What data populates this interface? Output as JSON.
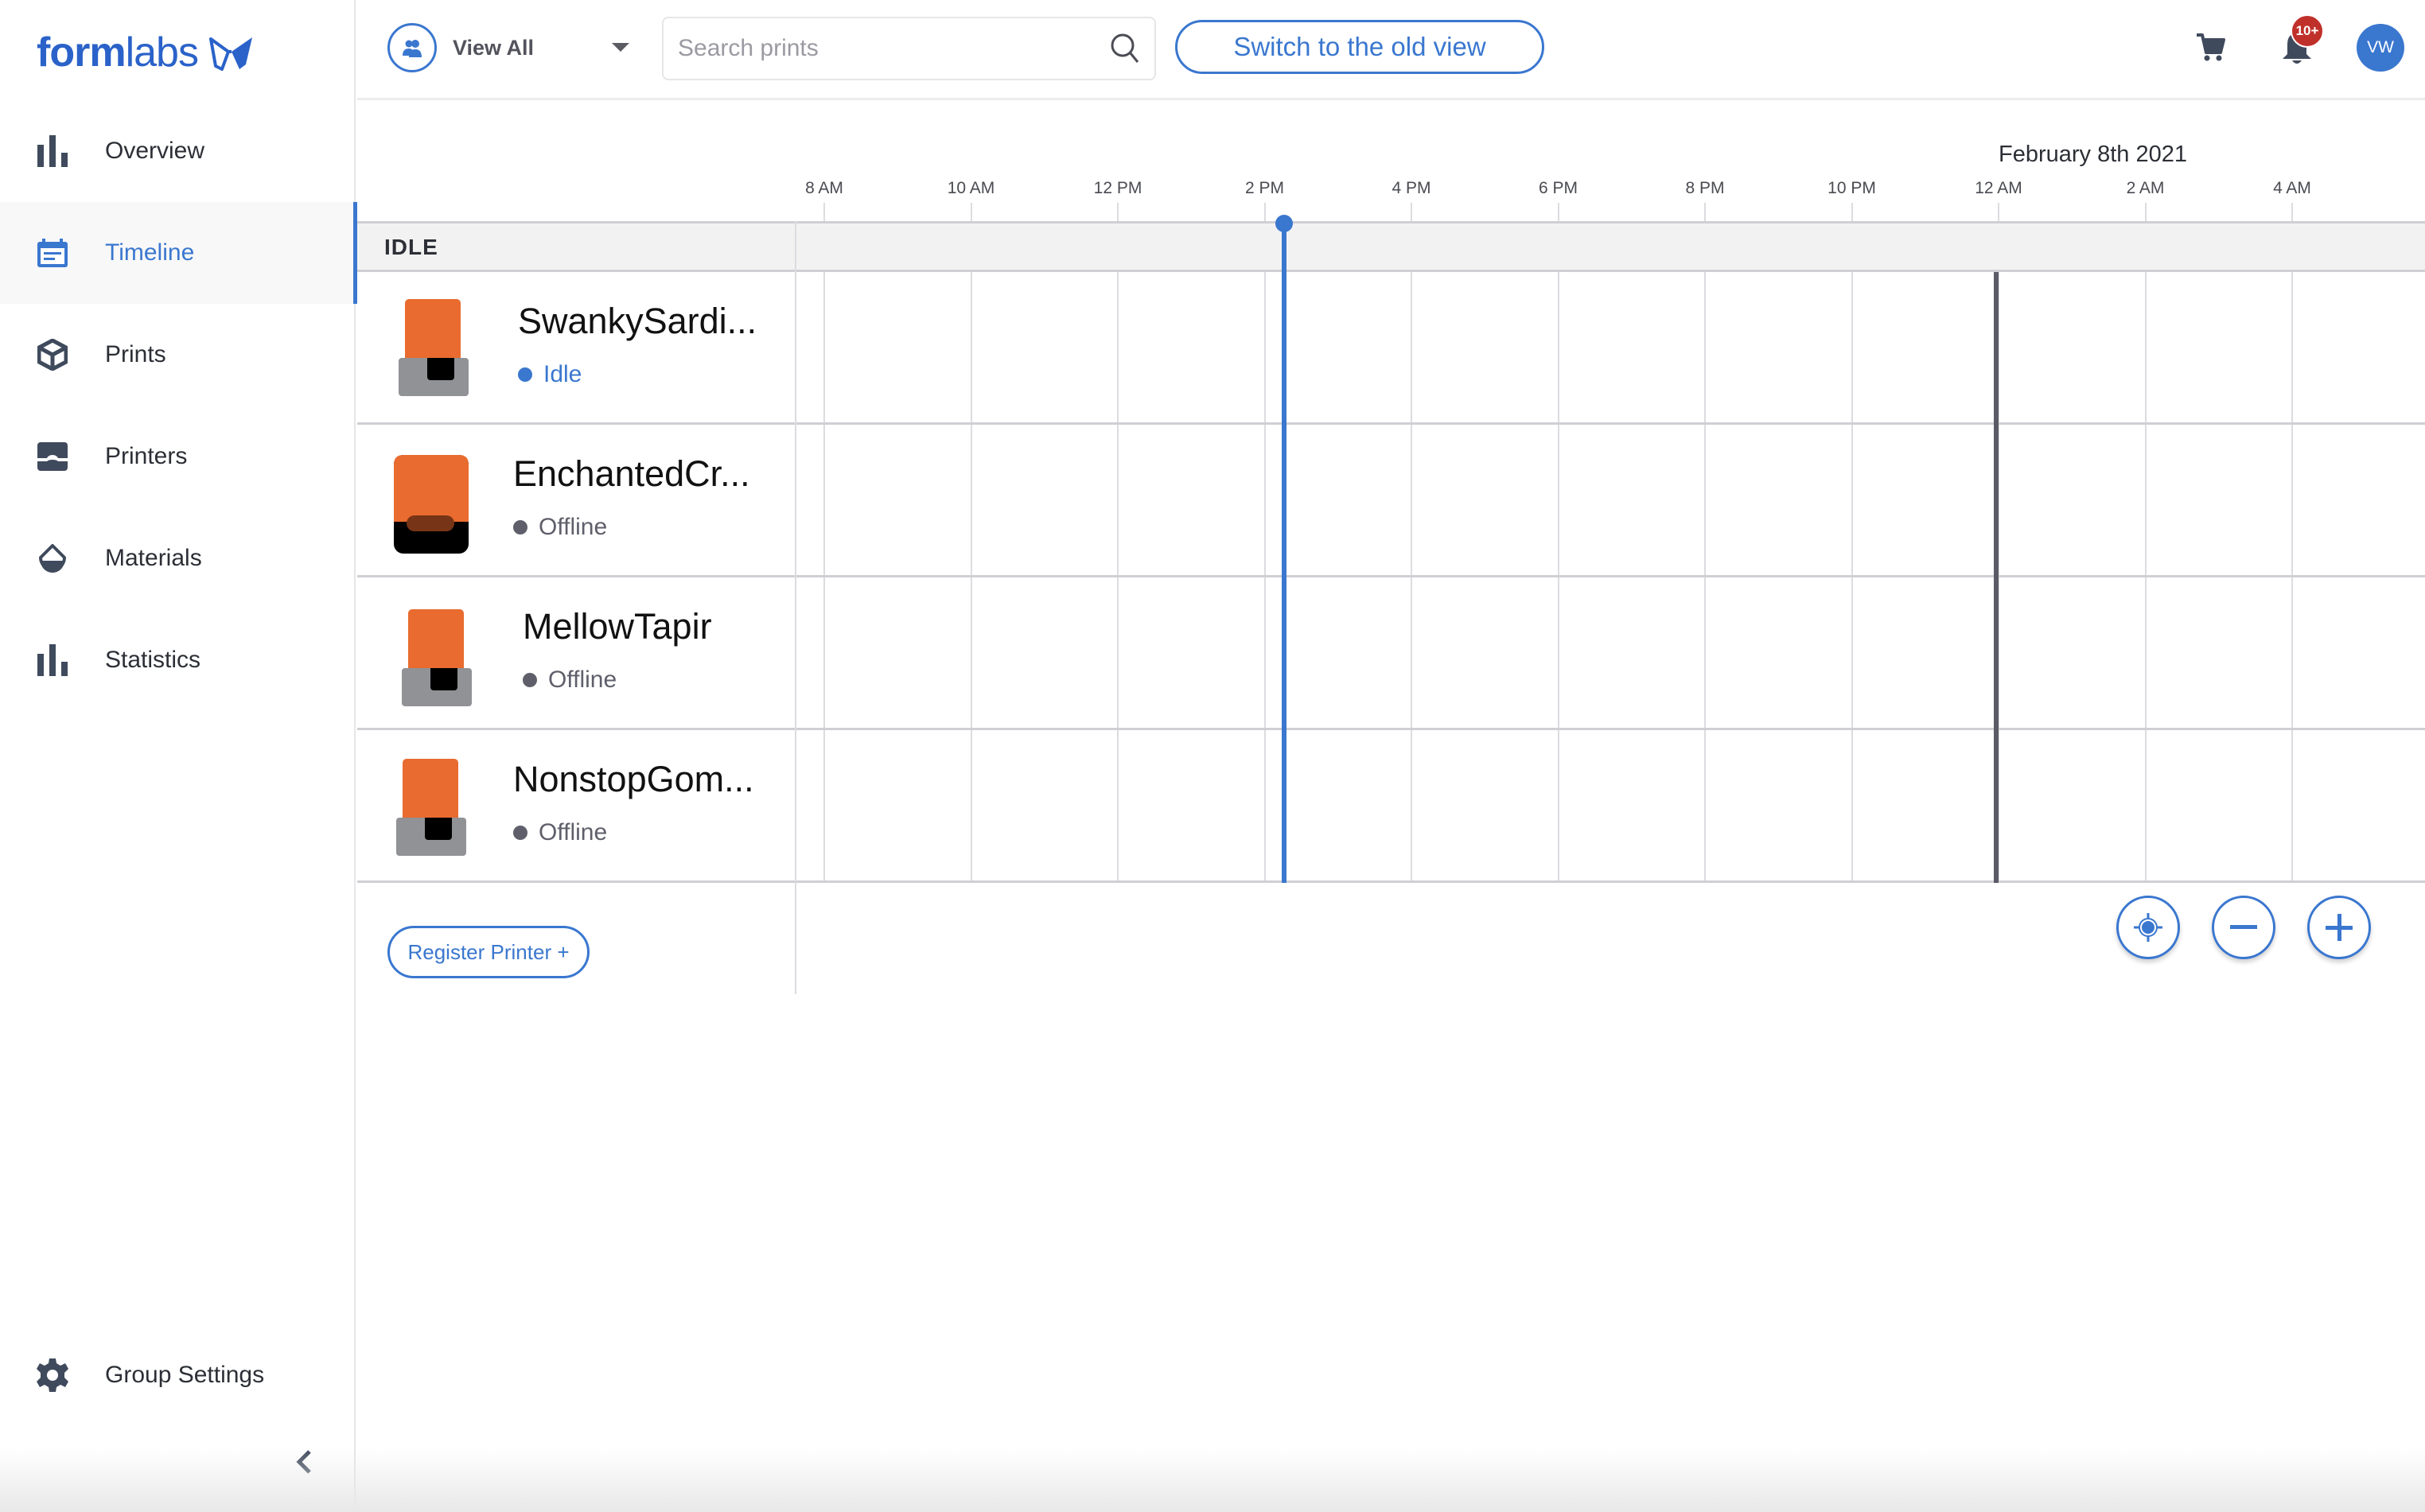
{
  "brand": {
    "logo_bold": "form",
    "logo_light": "labs",
    "accent": "#3a77cf"
  },
  "sidebar": {
    "items": [
      {
        "label": "Overview",
        "icon": "bar-chart-icon",
        "active": false
      },
      {
        "label": "Timeline",
        "icon": "calendar-icon",
        "active": true
      },
      {
        "label": "Prints",
        "icon": "cube-icon",
        "active": false
      },
      {
        "label": "Printers",
        "icon": "printer-icon",
        "active": false
      },
      {
        "label": "Materials",
        "icon": "resin-drop-icon",
        "active": false
      },
      {
        "label": "Statistics",
        "icon": "bar-chart-icon",
        "active": false
      }
    ],
    "group_settings": "Group Settings",
    "collapse_icon": "chevron-left-icon"
  },
  "topbar": {
    "view_filter": "View All",
    "search_placeholder": "Search prints",
    "search_value": "",
    "switch_view_label": "Switch to the old view",
    "notifications_badge": "10+",
    "avatar_initials": "VW"
  },
  "timeline": {
    "date_label": "February 8th 2021",
    "ticks": [
      "8 AM",
      "10 AM",
      "12 PM",
      "2 PM",
      "4 PM",
      "6 PM",
      "8 PM",
      "10 PM",
      "12 AM",
      "2 AM",
      "4 AM"
    ],
    "group_label": "IDLE",
    "now_marker_time": "2:15 PM",
    "day_boundary": "12 AM"
  },
  "printers": [
    {
      "name": "SwankySardi...",
      "status": "Idle",
      "status_color": "#3a77cf",
      "model": "form3"
    },
    {
      "name": "EnchantedCr...",
      "status": "Offline",
      "status_color": "#5e5f6a",
      "model": "form2"
    },
    {
      "name": "MellowTapir",
      "status": "Offline",
      "status_color": "#5e5f6a",
      "model": "form3"
    },
    {
      "name": "NonstopGom...",
      "status": "Offline",
      "status_color": "#5e5f6a",
      "model": "form3"
    }
  ],
  "actions": {
    "register_printer": "Register Printer +",
    "recenter": "crosshair-icon",
    "zoom_out": "minus-icon",
    "zoom_in": "plus-icon"
  }
}
